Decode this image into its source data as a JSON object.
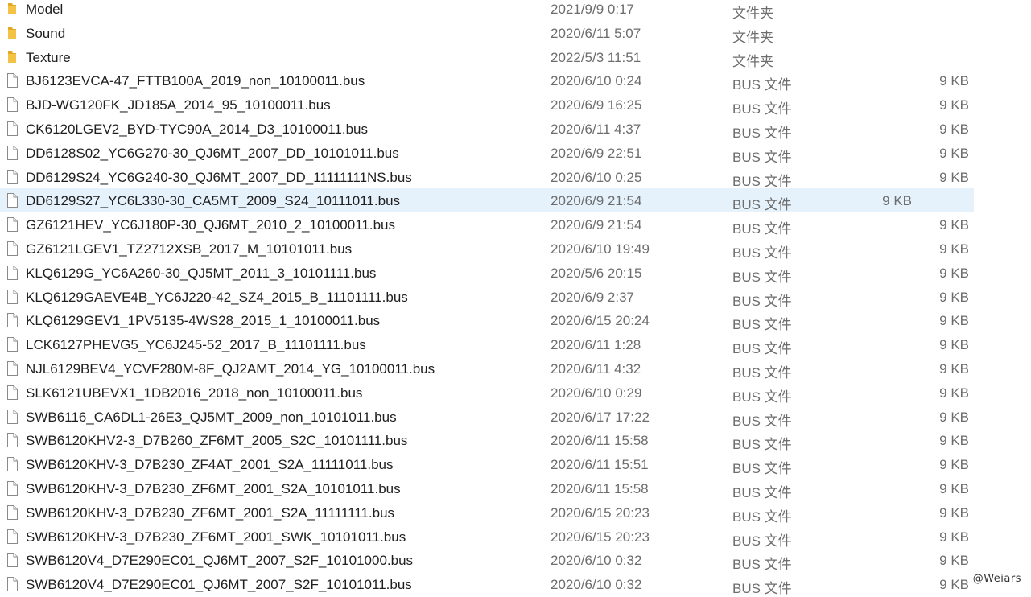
{
  "files": [
    {
      "name": "Model",
      "date": "2021/9/9 0:17",
      "type": "文件夹",
      "size": "",
      "kind": "folder"
    },
    {
      "name": "Sound",
      "date": "2020/6/11 5:07",
      "type": "文件夹",
      "size": "",
      "kind": "folder"
    },
    {
      "name": "Texture",
      "date": "2022/5/3 11:51",
      "type": "文件夹",
      "size": "",
      "kind": "folder"
    },
    {
      "name": "BJ6123EVCA-47_FTTB100A_2019_non_10100011.bus",
      "date": "2020/6/10 0:24",
      "type": "BUS 文件",
      "size": "9 KB",
      "kind": "file"
    },
    {
      "name": "BJD-WG120FK_JD185A_2014_95_10100011.bus",
      "date": "2020/6/9 16:25",
      "type": "BUS 文件",
      "size": "9 KB",
      "kind": "file"
    },
    {
      "name": "CK6120LGEV2_BYD-TYC90A_2014_D3_10100011.bus",
      "date": "2020/6/11 4:37",
      "type": "BUS 文件",
      "size": "9 KB",
      "kind": "file"
    },
    {
      "name": "DD6128S02_YC6G270-30_QJ6MT_2007_DD_10101011.bus",
      "date": "2020/6/9 22:51",
      "type": "BUS 文件",
      "size": "9 KB",
      "kind": "file"
    },
    {
      "name": "DD6129S24_YC6G240-30_QJ6MT_2007_DD_11111111NS.bus",
      "date": "2020/6/10 0:25",
      "type": "BUS 文件",
      "size": "9 KB",
      "kind": "file"
    },
    {
      "name": "DD6129S27_YC6L330-30_CA5MT_2009_S24_10111011.bus",
      "date": "2020/6/9 21:54",
      "type": "BUS 文件",
      "size": "9 KB",
      "kind": "file",
      "selected": true
    },
    {
      "name": "GZ6121HEV_YC6J180P-30_QJ6MT_2010_2_10100011.bus",
      "date": "2020/6/9 21:54",
      "type": "BUS 文件",
      "size": "9 KB",
      "kind": "file"
    },
    {
      "name": "GZ6121LGEV1_TZ2712XSB_2017_M_10101011.bus",
      "date": "2020/6/10 19:49",
      "type": "BUS 文件",
      "size": "9 KB",
      "kind": "file"
    },
    {
      "name": "KLQ6129G_YC6A260-30_QJ5MT_2011_3_10101111.bus",
      "date": "2020/5/6 20:15",
      "type": "BUS 文件",
      "size": "9 KB",
      "kind": "file"
    },
    {
      "name": "KLQ6129GAEVE4B_YC6J220-42_SZ4_2015_B_11101111.bus",
      "date": "2020/6/9 2:37",
      "type": "BUS 文件",
      "size": "9 KB",
      "kind": "file"
    },
    {
      "name": "KLQ6129GEV1_1PV5135-4WS28_2015_1_10100011.bus",
      "date": "2020/6/15 20:24",
      "type": "BUS 文件",
      "size": "9 KB",
      "kind": "file"
    },
    {
      "name": "LCK6127PHEVG5_YC6J245-52_2017_B_11101111.bus",
      "date": "2020/6/11 1:28",
      "type": "BUS 文件",
      "size": "9 KB",
      "kind": "file"
    },
    {
      "name": "NJL6129BEV4_YCVF280M-8F_QJ2AMT_2014_YG_10100011.bus",
      "date": "2020/6/11 4:32",
      "type": "BUS 文件",
      "size": "9 KB",
      "kind": "file"
    },
    {
      "name": "SLK6121UBEVX1_1DB2016_2018_non_10100011.bus",
      "date": "2020/6/10 0:29",
      "type": "BUS 文件",
      "size": "9 KB",
      "kind": "file"
    },
    {
      "name": "SWB6116_CA6DL1-26E3_QJ5MT_2009_non_10101011.bus",
      "date": "2020/6/17 17:22",
      "type": "BUS 文件",
      "size": "9 KB",
      "kind": "file"
    },
    {
      "name": "SWB6120KHV2-3_D7B260_ZF6MT_2005_S2C_10101111.bus",
      "date": "2020/6/11 15:58",
      "type": "BUS 文件",
      "size": "9 KB",
      "kind": "file"
    },
    {
      "name": "SWB6120KHV-3_D7B230_ZF4AT_2001_S2A_11111011.bus",
      "date": "2020/6/11 15:51",
      "type": "BUS 文件",
      "size": "9 KB",
      "kind": "file"
    },
    {
      "name": "SWB6120KHV-3_D7B230_ZF6MT_2001_S2A_10101011.bus",
      "date": "2020/6/11 15:58",
      "type": "BUS 文件",
      "size": "9 KB",
      "kind": "file"
    },
    {
      "name": "SWB6120KHV-3_D7B230_ZF6MT_2001_S2A_11111111.bus",
      "date": "2020/6/15 20:23",
      "type": "BUS 文件",
      "size": "9 KB",
      "kind": "file"
    },
    {
      "name": "SWB6120KHV-3_D7B230_ZF6MT_2001_SWK_10101011.bus",
      "date": "2020/6/15 20:23",
      "type": "BUS 文件",
      "size": "9 KB",
      "kind": "file"
    },
    {
      "name": "SWB6120V4_D7E290EC01_QJ6MT_2007_S2F_10101000.bus",
      "date": "2020/6/10 0:32",
      "type": "BUS 文件",
      "size": "9 KB",
      "kind": "file"
    },
    {
      "name": "SWB6120V4_D7E290EC01_QJ6MT_2007_S2F_10101011.bus",
      "date": "2020/6/10 0:32",
      "type": "BUS 文件",
      "size": "9 KB",
      "kind": "file"
    }
  ],
  "watermark": "@Weiars",
  "colors": {
    "selection": "#e5f1fb",
    "folder": "#f4c247",
    "folder_dark": "#e2a925",
    "text": "#1f1f1f",
    "meta_text": "#6d6d6d"
  }
}
